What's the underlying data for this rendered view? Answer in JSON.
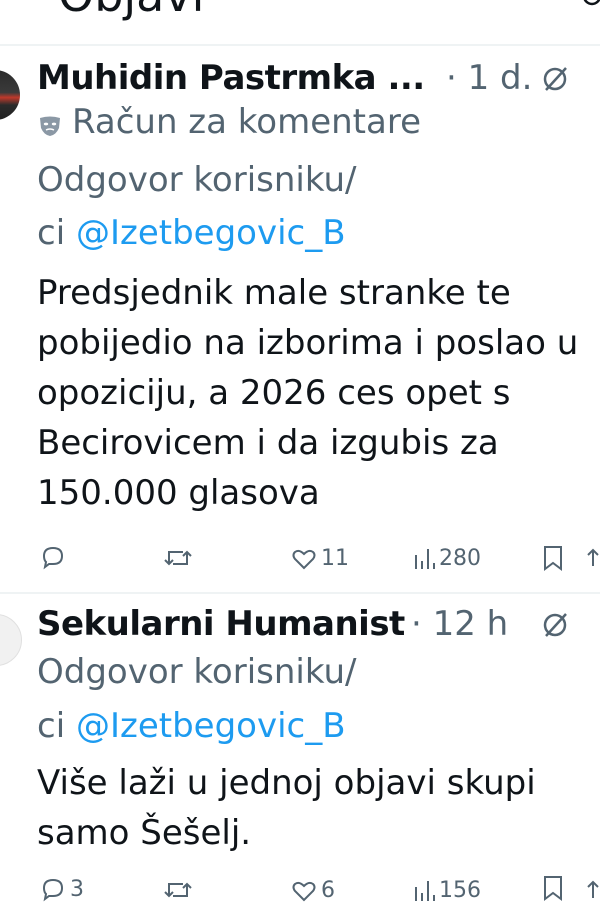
{
  "header": {
    "title": "Objavi"
  },
  "posts": [
    {
      "author": "Muhidin Pastrmka ...",
      "time": "· 1 d.",
      "account_label": "Račun za komentare",
      "reply_prefix_1": "Odgovor korisniku/",
      "reply_prefix_2": "ci",
      "mention": "@Izetbegovic_B",
      "text_lines": [
        "Predsjednik male stranke te",
        "pobijedio na izborima i poslao u",
        "opoziciju, a 2026 ces opet s",
        "Becirovicem i da izgubis za",
        "150.000 glasova"
      ],
      "stats": {
        "replies": "",
        "reposts": "",
        "likes": "11",
        "views": "280"
      }
    },
    {
      "author": "Sekularni Humanist",
      "time": "· 12 h",
      "reply_prefix_1": "Odgovor korisniku/",
      "reply_prefix_2": "ci",
      "mention": "@Izetbegovic_B",
      "text_lines": [
        "Više laži u jednoj objavi skupi",
        "samo Šešelj."
      ],
      "stats": {
        "replies": "3",
        "reposts": "",
        "likes": "6",
        "views": "156"
      }
    }
  ],
  "colors": {
    "text": "#0f1419",
    "muted": "#536471",
    "link": "#1d9bf0",
    "divider": "#eff3f4"
  },
  "icons": [
    "grok-icon",
    "mask-icon",
    "reply-icon",
    "repost-icon",
    "like-icon",
    "views-icon",
    "bookmark-icon",
    "share-icon"
  ]
}
